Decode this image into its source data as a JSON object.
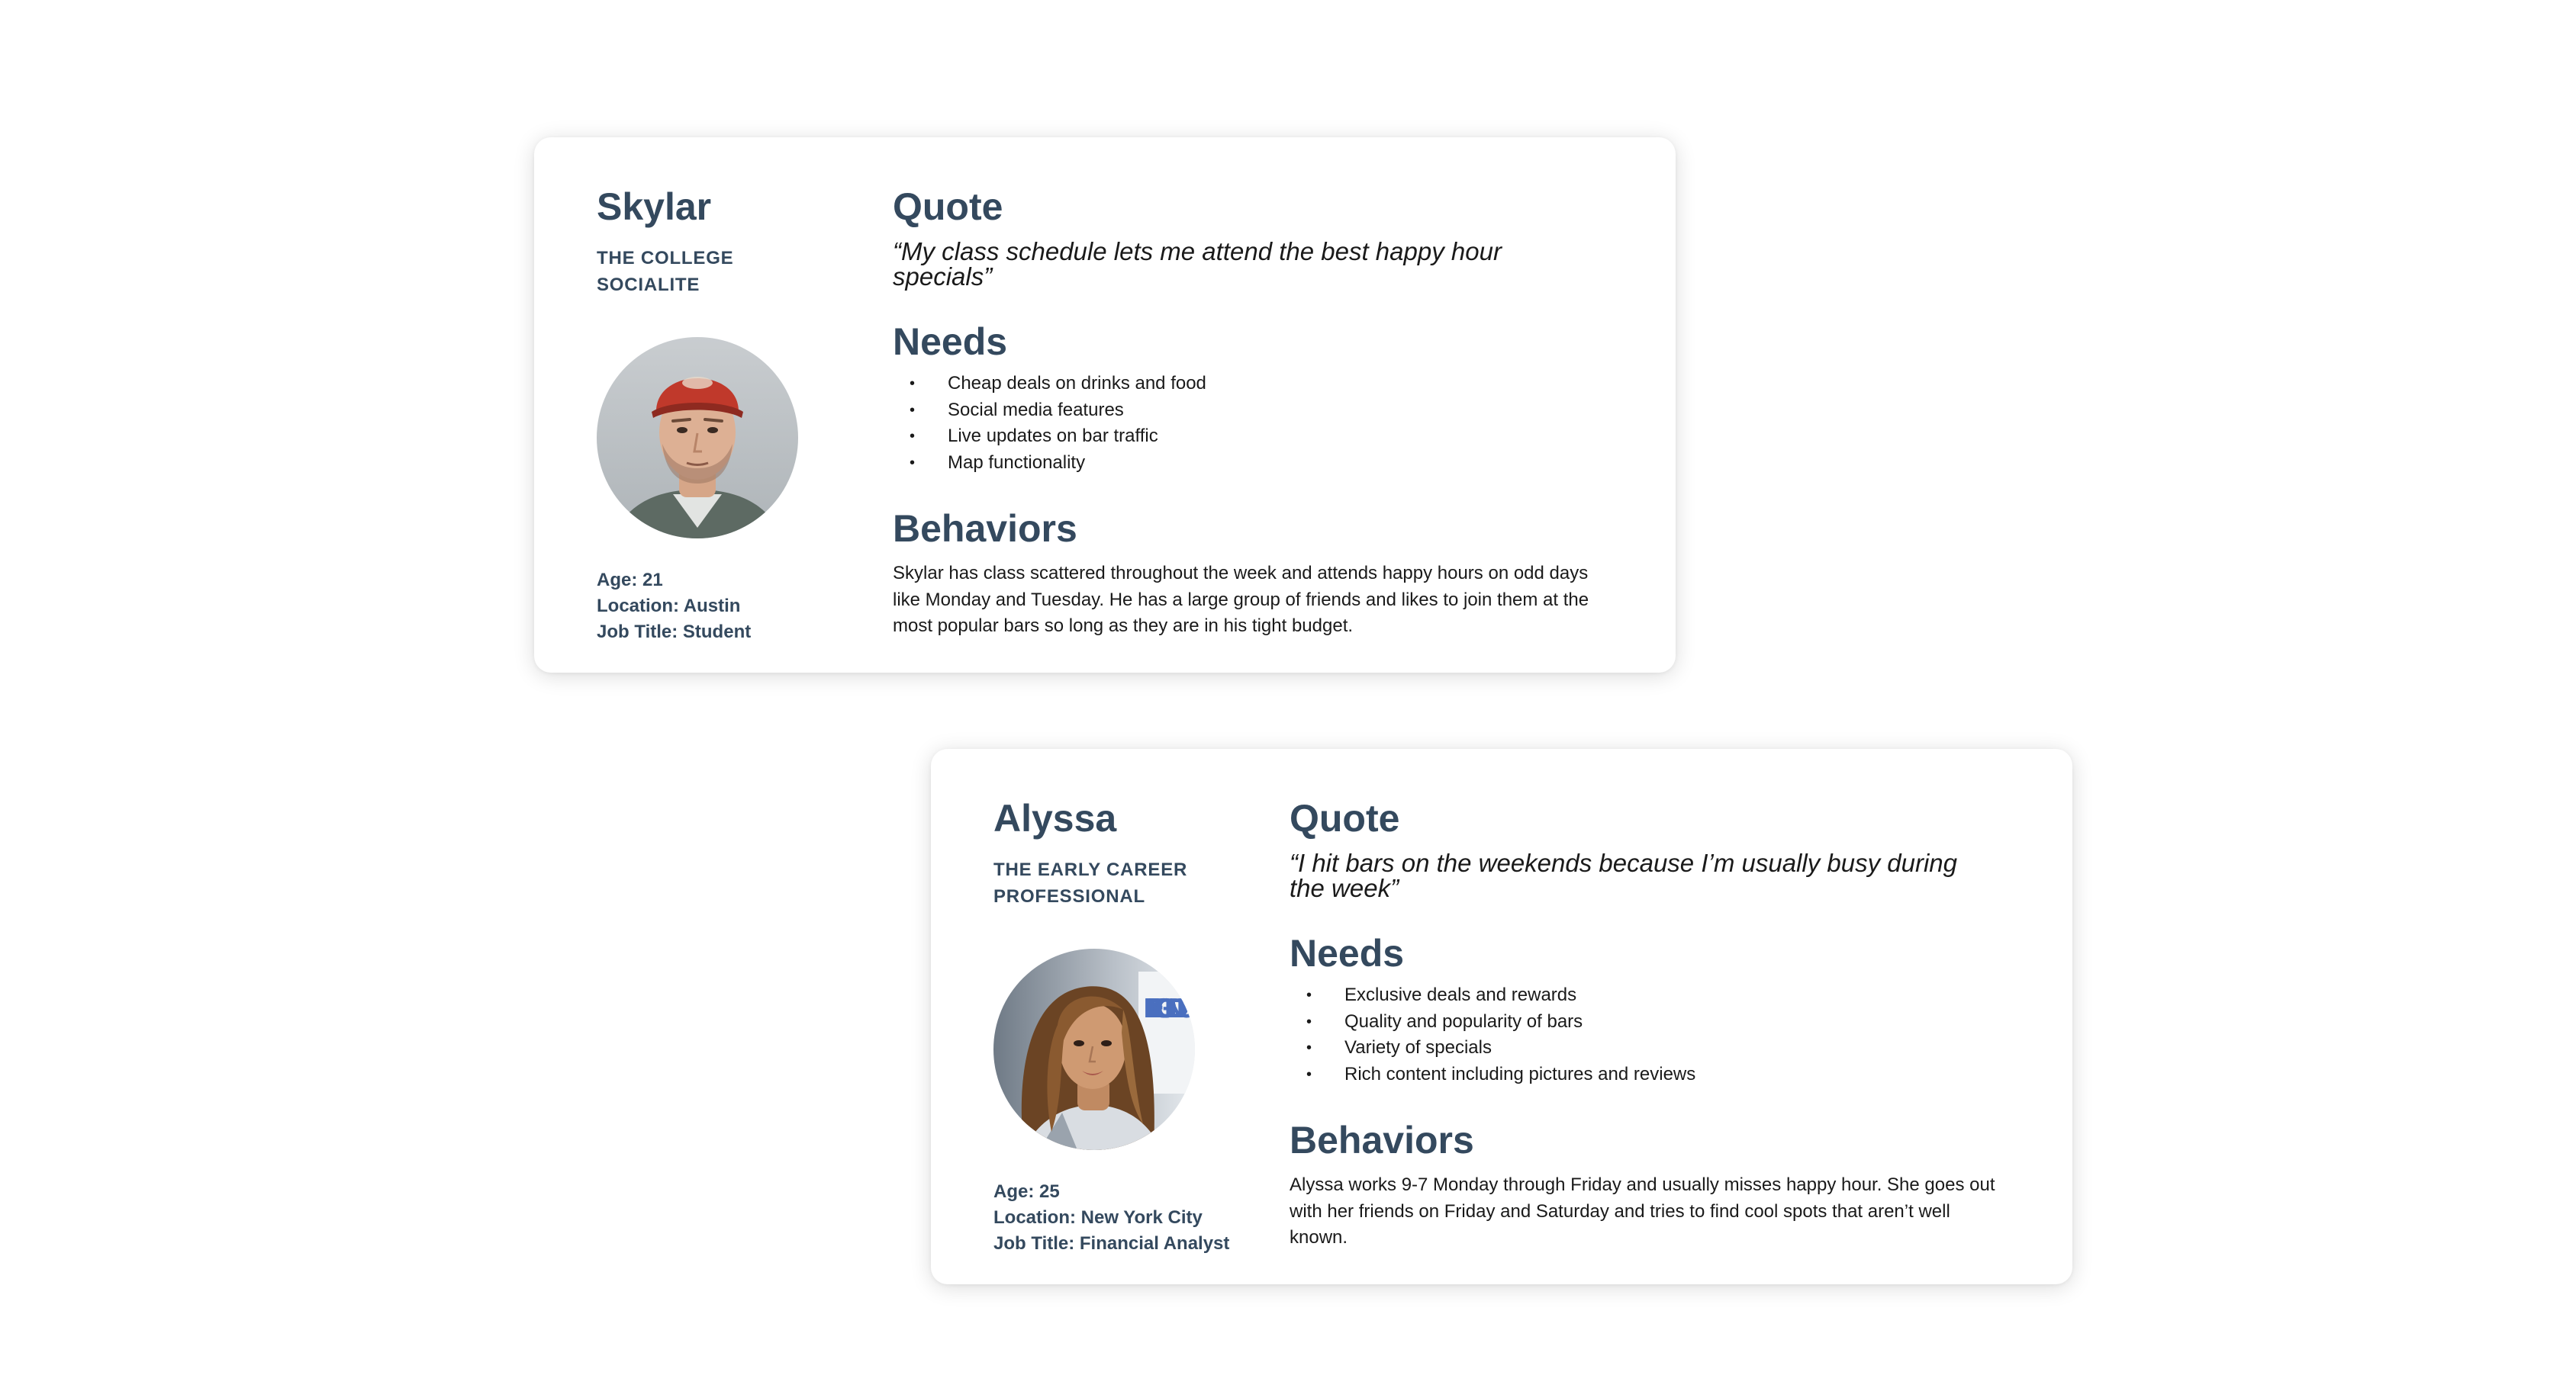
{
  "personas": [
    {
      "name": "Skylar",
      "archetype_line1": "THE COLLEGE",
      "archetype_line2": "SOCIALITE",
      "age": "Age: 21",
      "location": "Location: Austin",
      "job_title": "Job Title: Student",
      "quote_heading": "Quote",
      "quote": "“My class schedule lets me attend the best happy hour specials”",
      "needs_heading": "Needs",
      "needs": [
        "Cheap deals on drinks and food",
        "Social media features",
        "Live updates on bar traffic",
        "Map functionality"
      ],
      "behaviors_heading": "Behaviors",
      "behaviors": "Skylar has class scattered throughout the week and attends happy hours on odd days like Monday and Tuesday. He has a large group of friends and likes to join them at the most popular bars so long as they are in his tight budget."
    },
    {
      "name": "Alyssa",
      "archetype_line1": "THE EARLY CAREER",
      "archetype_line2": "PROFESSIONAL",
      "age": "Age: 25",
      "location": "Location: New York City",
      "job_title": "Job Title: Financial Analyst",
      "quote_heading": "Quote",
      "quote": "“I hit bars on the weekends because I’m usually busy during the week”",
      "needs_heading": "Needs",
      "needs": [
        "Exclusive deals and rewards",
        "Quality and popularity of bars",
        "Variety of specials",
        "Rich content including pictures and reviews"
      ],
      "behaviors_heading": "Behaviors",
      "behaviors": "Alyssa works 9-7 Monday through Friday and usually misses happy hour. She goes out with her friends on Friday and Saturday and tries to find cool spots that aren’t well known.",
      "photo_sign_text": "LIFEG ON DU"
    }
  ],
  "colors": {
    "heading": "#34495e",
    "body_text": "#1a1a1a",
    "card_background": "#ffffff"
  }
}
